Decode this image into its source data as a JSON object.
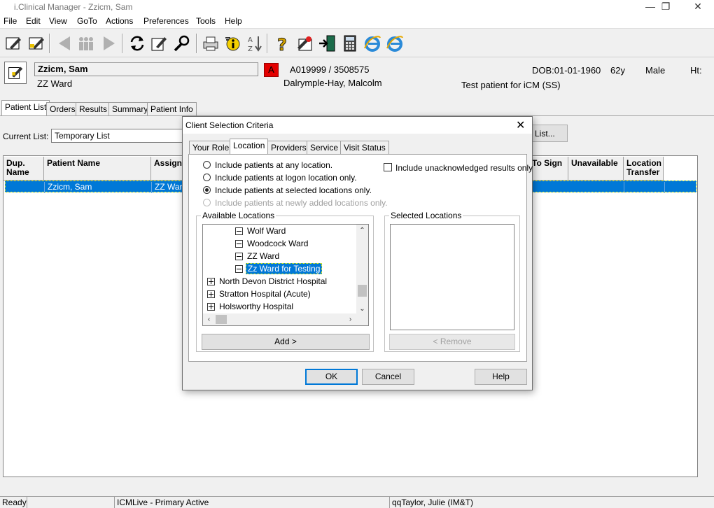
{
  "window": {
    "title": "i.Clinical Manager - Zzicm, Sam"
  },
  "menu": [
    "File",
    "Edit",
    "View",
    "GoTo",
    "Actions",
    "Preferences",
    "Tools",
    "Help"
  ],
  "patient": {
    "name": "Zzicm, Sam",
    "ward": "ZZ Ward",
    "alert": "A",
    "ids": "A019999 / 3508575",
    "consultant": "Dalrymple-Hay, Malcolm",
    "dob": "DOB:01-01-1960",
    "age": "62y",
    "sex": "Male",
    "ht": "Ht:",
    "note": "Test patient for iCM (SS)"
  },
  "tabs": [
    "Patient List",
    "Orders",
    "Results",
    "Summary",
    "Patient Info"
  ],
  "current_list": {
    "label": "Current List:",
    "value": "Temporary List",
    "button": "List..."
  },
  "grid": {
    "headers": {
      "dup": "Dup. Name",
      "patient": "Patient Name",
      "assigned": "Assigne",
      "to_sign": "To Sign",
      "unavailable": "Unavailable",
      "location_transfer": "Location Transfer"
    },
    "row": {
      "patient": "Zzicm, Sam",
      "assigned": "ZZ War"
    }
  },
  "dialog": {
    "title": "Client Selection Criteria",
    "tabs": [
      "Your Role",
      "Location",
      "Providers",
      "Service",
      "Visit Status"
    ],
    "radios": [
      "Include patients at any location.",
      "Include patients at logon location only.",
      "Include patients at selected locations only.",
      "Include patients at newly added locations only."
    ],
    "checkbox": "Include unacknowledged results only",
    "available_label": "Available Locations",
    "selected_label": "Selected Locations",
    "tree": [
      "Wolf Ward",
      "Woodcock Ward",
      "ZZ Ward",
      "Zz Ward for Testing",
      "North Devon District Hospital",
      "Stratton Hospital (Acute)",
      "Holsworthy Hospital"
    ],
    "add_button": "Add >",
    "remove_button": "< Remove",
    "ok": "OK",
    "cancel": "Cancel",
    "help": "Help"
  },
  "status": {
    "ready": "Ready",
    "env": "ICMLive - Primary Active",
    "user": "qqTaylor, Julie (IM&T)"
  },
  "colors": {
    "selection": "#0078d7",
    "alert": "#e30000"
  }
}
